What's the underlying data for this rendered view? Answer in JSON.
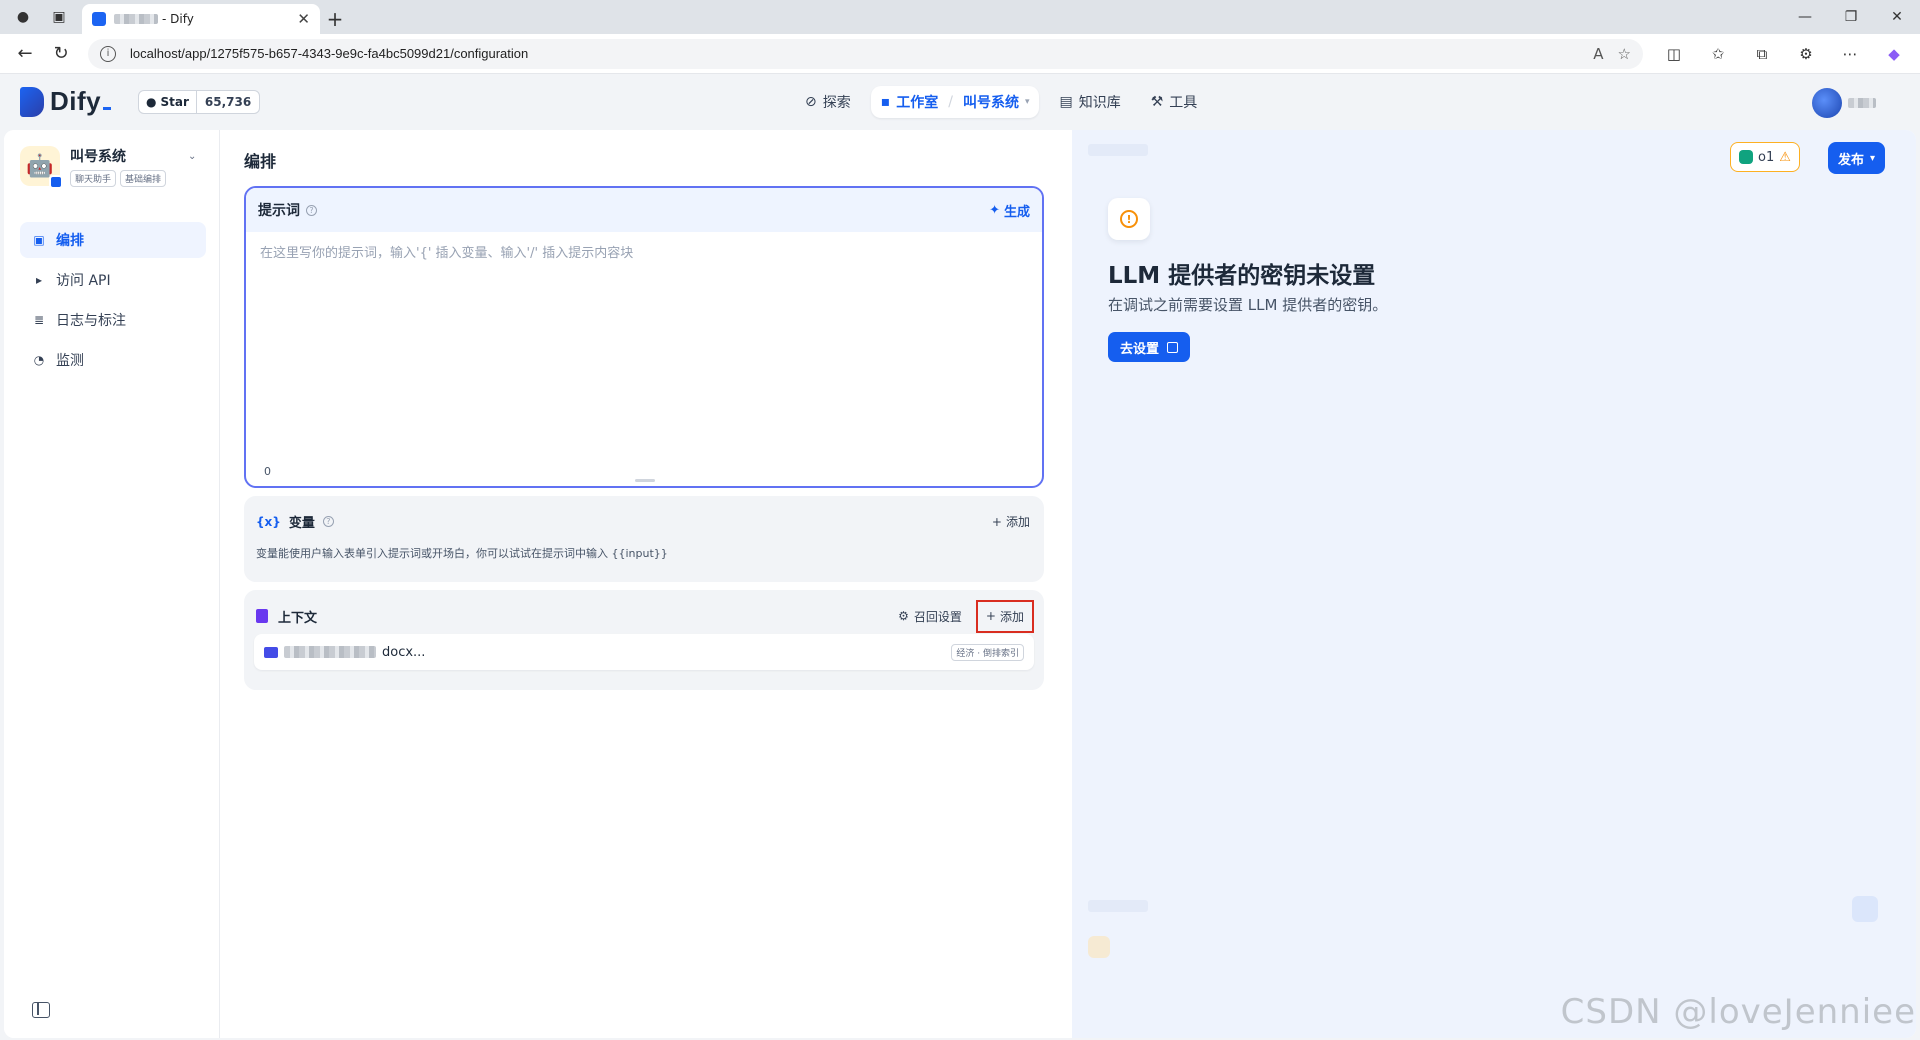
{
  "browser": {
    "tab_title_suffix": "- Dify",
    "url": "localhost/app/1275f575-b657-4343-9e9c-fa4bc5099d21/configuration"
  },
  "header": {
    "logo_text": "Dify",
    "github_star_label": "Star",
    "github_star_count": "65,736",
    "nav": {
      "explore": "探索",
      "studio": "工作室",
      "separator": "/",
      "current_app": "叫号系统",
      "knowledge": "知识库",
      "tools": "工具"
    }
  },
  "sidebar": {
    "app_name": "叫号系统",
    "tags": [
      "聊天助手",
      "基础编排"
    ],
    "items": [
      {
        "label": "编排",
        "icon": "layout-icon",
        "active": true
      },
      {
        "label": "访问 API",
        "icon": "terminal-icon",
        "active": false
      },
      {
        "label": "日志与标注",
        "icon": "file-list-icon",
        "active": false
      },
      {
        "label": "监测",
        "icon": "dashboard-icon",
        "active": false
      }
    ]
  },
  "orchestrate": {
    "page_title": "编排",
    "prompt": {
      "title": "提示词",
      "generate_label": "生成",
      "placeholder": "在这里写你的提示词，输入'{' 插入变量、输入'/' 插入提示内容块",
      "char_count": "0"
    },
    "variables": {
      "title": "变量",
      "add_label": "添加",
      "description": "变量能使用户输入表单引入提示词或开场白，你可以试试在提示词中输入 {{input}}"
    },
    "context": {
      "title": "上下文",
      "recall_label": "召回设置",
      "add_label": "添加",
      "dataset_suffix": "docx...",
      "dataset_badge": "经济 · 倒排索引"
    }
  },
  "toolbar": {
    "model_label": "o1",
    "publish_label": "发布"
  },
  "debug": {
    "warning_title": "LLM 提供者的密钥未设置",
    "warning_desc": "在调试之前需要设置 LLM 提供者的密钥。",
    "setup_label": "去设置"
  },
  "watermark": "CSDN @loveJenniee",
  "colors": {
    "primary": "#155eef",
    "prompt_border": "#6172f3",
    "warning": "#f79009",
    "highlight": "#d92d20"
  }
}
